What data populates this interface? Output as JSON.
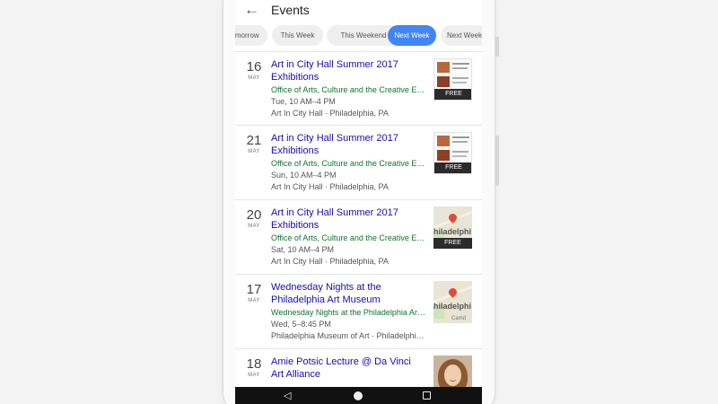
{
  "appbar": {
    "back_icon": "arrow-back-icon",
    "title": "Events"
  },
  "chips": [
    {
      "label": "Tomorrow",
      "active": false
    },
    {
      "label": "This Week",
      "active": false
    },
    {
      "label": "This Weekend",
      "active": false
    },
    {
      "label": "Next Week",
      "active": true
    },
    {
      "label": "Next Weekend",
      "active": false
    }
  ],
  "events": [
    {
      "day": "16",
      "month": "MAY",
      "title": "Art in City Hall Summer 2017 Exhibitions",
      "organizer": "Office of Arts, Culture and the Creative Economy",
      "time": "Tue, 10 AM–4 PM",
      "venue": "Art In City Hall · Philadelphia, PA",
      "thumb": "poster",
      "badge": "FREE"
    },
    {
      "day": "21",
      "month": "MAY",
      "title": "Art in City Hall Summer 2017 Exhibitions",
      "organizer": "Office of Arts, Culture and the Creative Economy",
      "time": "Sun, 10 AM–4 PM",
      "venue": "Art In City Hall · Philadelphia, PA",
      "thumb": "poster",
      "badge": "FREE"
    },
    {
      "day": "20",
      "month": "MAY",
      "title": "Art in City Hall Summer 2017 Exhibitions",
      "organizer": "Office of Arts, Culture and the Creative Economy",
      "time": "Sat, 10 AM–4 PM",
      "venue": "Art In City Hall · Philadelphia, PA",
      "thumb": "map",
      "badge": "FREE",
      "map_label": "hiladelphi"
    },
    {
      "day": "17",
      "month": "MAY",
      "title": "Wednesday Nights at the Philadelphia Art Museum",
      "organizer": "Wednesday Nights at the Philadelphia Art Museum",
      "time": "Wed, 5–8:45 PM",
      "venue": "Philadelphia Museum of Art · Philadelphia, PA",
      "thumb": "map",
      "map_label": "hiladelphi",
      "map_label2": "Camd"
    },
    {
      "day": "18",
      "month": "MAY",
      "title": "Amie Potsic Lecture @ Da Vinci Art Alliance",
      "thumb": "photo"
    }
  ],
  "navbar": {
    "back_icon": "nav-back-icon",
    "home_icon": "nav-home-icon",
    "recents_icon": "nav-recents-icon"
  },
  "colors": {
    "accent": "#4285f4",
    "title_link": "#1a0dab",
    "organizer": "#137333"
  }
}
